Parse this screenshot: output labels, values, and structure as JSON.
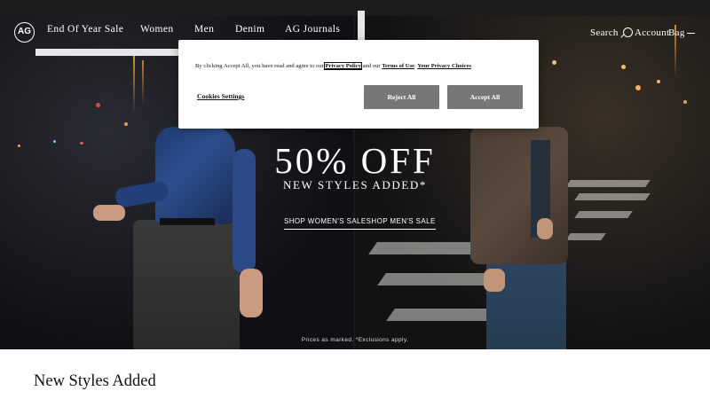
{
  "header": {
    "logo": "AG",
    "nav": [
      "End Of Year Sale",
      "Women",
      "Men",
      "Denim",
      "AG Journals"
    ],
    "search_label": "Search",
    "account_label": "Account",
    "bag_label": "Bag"
  },
  "hero": {
    "title": "50% OFF",
    "subtitle": "NEW STYLES ADDED*",
    "cta_women": "SHOP WOMEN'S SALE",
    "cta_men": "SHOP MEN'S SALE",
    "disclaimer": "Prices as marked. *Exclusions apply."
  },
  "section": {
    "title": "New Styles Added"
  },
  "cookie_modal": {
    "text_prefix": "By clicking Accept All, you have read and agree to our ",
    "privacy_policy": "Privacy Policy",
    "text_middle": " and our ",
    "terms_of_use": "Terms of Use",
    "text_sep": ". ",
    "privacy_choices": "Your Privacy Choices",
    "cookie_settings": "Cookies Settings",
    "reject_all": "Reject All",
    "accept_all": "Accept All"
  },
  "icons": {
    "logo": "ag-logo-icon",
    "search": "search-icon",
    "menu": "menu-icon"
  },
  "colors": {
    "modal_button": "#777777",
    "topbar": "#1c1c1c"
  }
}
